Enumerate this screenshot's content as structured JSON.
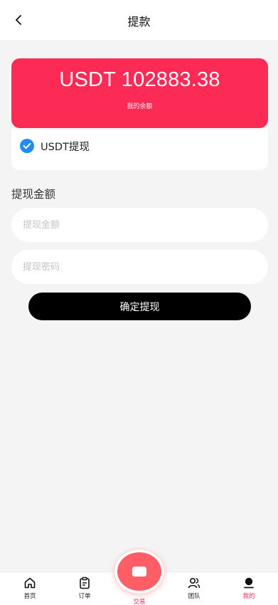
{
  "header": {
    "title": "提款"
  },
  "balance": {
    "amount": "USDT 102883.38",
    "label": "我的余额"
  },
  "method": {
    "label": "USDT提现",
    "selected": true
  },
  "form": {
    "section_title": "提现金额",
    "amount_placeholder": "提现金额",
    "password_placeholder": "提现密码",
    "amount_value": "",
    "password_value": "",
    "submit_label": "确定提现"
  },
  "tabbar": {
    "items": [
      {
        "label": "首页",
        "icon": "home-icon",
        "active": false
      },
      {
        "label": "订单",
        "icon": "clipboard-icon",
        "active": false
      },
      {
        "label": "交易",
        "icon": "wallet-icon",
        "active": false
      },
      {
        "label": "团队",
        "icon": "users-icon",
        "active": false
      },
      {
        "label": "我的",
        "icon": "user-icon",
        "active": true
      }
    ]
  },
  "colors": {
    "accent": "#fb2b55",
    "check": "#1f8cf5",
    "trade_button": "#ff5e66",
    "background": "#f4f4f4"
  }
}
